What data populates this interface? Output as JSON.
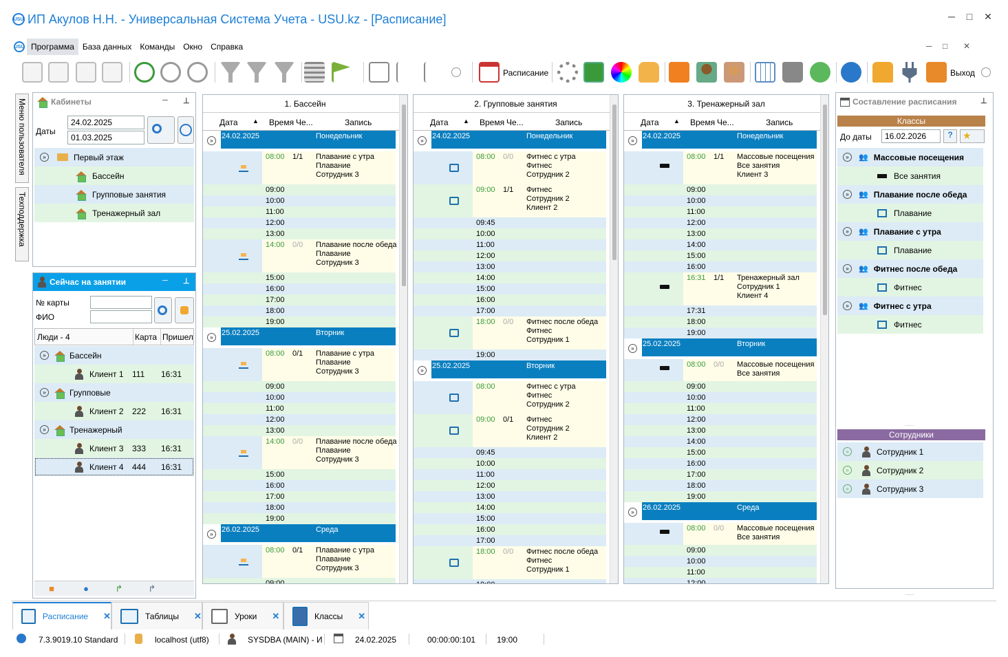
{
  "window": {
    "title": "ИП Акулов Н.Н. - Универсальная Система Учета - USU.kz - [Расписание]",
    "logo": "USU",
    "controls": [
      "─",
      "□",
      "✕"
    ]
  },
  "menu": {
    "items": [
      "Программа",
      "База данных",
      "Команды",
      "Окно",
      "Справка"
    ]
  },
  "toolbar": {
    "schedule_label": "Расписание",
    "exit_label": "Выход"
  },
  "side_tabs": [
    "Меню пользователя",
    "Техподдержка"
  ],
  "cabinets": {
    "title": "Кабинеты",
    "dates_label": "Даты",
    "date_from": "24.02.2025",
    "date_to": "01.03.2025",
    "tree": {
      "root": "Первый этаж",
      "children": [
        "Бассейн",
        "Групповые занятия",
        "Тренажерный зал"
      ]
    }
  },
  "now": {
    "title": "Сейчас на занятии",
    "card_label": "№ карты",
    "name_label": "ФИО",
    "columns": [
      "Люди - 4",
      "Карта",
      "Пришел"
    ],
    "groups": [
      {
        "name": "Бассейн",
        "clients": [
          {
            "name": "Клиент 1",
            "card": "111",
            "time": "16:31"
          }
        ]
      },
      {
        "name": "Групповые",
        "clients": [
          {
            "name": "Клиент 2",
            "card": "222",
            "time": "16:31"
          }
        ]
      },
      {
        "name": "Тренажерный",
        "clients": [
          {
            "name": "Клиент 3",
            "card": "333",
            "time": "16:31"
          },
          {
            "name": "Клиент 4",
            "card": "444",
            "time": "16:31"
          }
        ]
      }
    ]
  },
  "grid_columns": {
    "date": "Дата",
    "time": "Время",
    "count": "Че...",
    "record": "Запись"
  },
  "schedules": [
    {
      "title": "1. Бассейн",
      "rows": [
        {
          "k": "day",
          "date": "24.02.2025",
          "dow": "Понедельник"
        },
        {
          "k": "e",
          "time": "08:00",
          "n": "1/1",
          "text": "Плавание с утра\nПлавание\nСотрудник 3",
          "icon": "swim"
        },
        {
          "k": "s",
          "time": "09:00"
        },
        {
          "k": "s",
          "time": "10:00"
        },
        {
          "k": "s",
          "time": "11:00"
        },
        {
          "k": "s",
          "time": "12:00"
        },
        {
          "k": "s",
          "time": "13:00"
        },
        {
          "k": "e",
          "time": "14:00",
          "n": "0/0",
          "text": "Плавание после обеда\nПлавание\nСотрудник 3",
          "icon": "swim"
        },
        {
          "k": "s",
          "time": "15:00"
        },
        {
          "k": "s",
          "time": "16:00"
        },
        {
          "k": "s",
          "time": "17:00"
        },
        {
          "k": "s",
          "time": "18:00"
        },
        {
          "k": "s",
          "time": "19:00"
        },
        {
          "k": "day",
          "date": "25.02.2025",
          "dow": "Вторник"
        },
        {
          "k": "e",
          "time": "08:00",
          "n": "0/1",
          "text": "Плавание с утра\nПлавание\nСотрудник 3",
          "icon": "swim"
        },
        {
          "k": "s",
          "time": "09:00"
        },
        {
          "k": "s",
          "time": "10:00"
        },
        {
          "k": "s",
          "time": "11:00"
        },
        {
          "k": "s",
          "time": "12:00"
        },
        {
          "k": "s",
          "time": "13:00"
        },
        {
          "k": "e",
          "time": "14:00",
          "n": "0/0",
          "text": "Плавание после обеда\nПлавание\nСотрудник 3",
          "icon": "swim"
        },
        {
          "k": "s",
          "time": "15:00"
        },
        {
          "k": "s",
          "time": "16:00"
        },
        {
          "k": "s",
          "time": "17:00"
        },
        {
          "k": "s",
          "time": "18:00"
        },
        {
          "k": "s",
          "time": "19:00"
        },
        {
          "k": "day",
          "date": "26.02.2025",
          "dow": "Среда"
        },
        {
          "k": "e",
          "time": "08:00",
          "n": "0/1",
          "text": "Плавание с утра\nПлавание\nСотрудник 3",
          "icon": "swim"
        },
        {
          "k": "s",
          "time": "09:00"
        }
      ]
    },
    {
      "title": "2. Групповые занятия",
      "rows": [
        {
          "k": "day",
          "date": "24.02.2025",
          "dow": "Понедельник"
        },
        {
          "k": "e",
          "time": "08:00",
          "n": "0/0",
          "text": "Фитнес с утра\nФитнес\nСотрудник 2",
          "icon": "run"
        },
        {
          "k": "e",
          "time": "09:00",
          "n": "1/1",
          "text": "Фитнес\nСотрудник 2\nКлиент 2",
          "icon": "run"
        },
        {
          "k": "s",
          "time": "09:45"
        },
        {
          "k": "s",
          "time": "10:00"
        },
        {
          "k": "s",
          "time": "11:00"
        },
        {
          "k": "s",
          "time": "12:00"
        },
        {
          "k": "s",
          "time": "13:00"
        },
        {
          "k": "s",
          "time": "14:00"
        },
        {
          "k": "s",
          "time": "15:00"
        },
        {
          "k": "s",
          "time": "16:00"
        },
        {
          "k": "s",
          "time": "17:00"
        },
        {
          "k": "e",
          "time": "18:00",
          "n": "0/0",
          "text": "Фитнес после обеда\nФитнес\nСотрудник 1",
          "icon": "run"
        },
        {
          "k": "s",
          "time": "19:00"
        },
        {
          "k": "day",
          "date": "25.02.2025",
          "dow": "Вторник"
        },
        {
          "k": "e",
          "time": "08:00",
          "n": "",
          "text": "Фитнес с утра\nФитнес\nСотрудник 2",
          "icon": "run"
        },
        {
          "k": "e",
          "time": "09:00",
          "n": "0/1",
          "text": "Фитнес\nСотрудник 2\nКлиент 2",
          "icon": "run"
        },
        {
          "k": "s",
          "time": "09:45"
        },
        {
          "k": "s",
          "time": "10:00"
        },
        {
          "k": "s",
          "time": "11:00"
        },
        {
          "k": "s",
          "time": "12:00"
        },
        {
          "k": "s",
          "time": "13:00"
        },
        {
          "k": "s",
          "time": "14:00"
        },
        {
          "k": "s",
          "time": "15:00"
        },
        {
          "k": "s",
          "time": "16:00"
        },
        {
          "k": "s",
          "time": "17:00"
        },
        {
          "k": "e",
          "time": "18:00",
          "n": "0/0",
          "text": "Фитнес после обеда\nФитнес\nСотрудник 1",
          "icon": "run"
        },
        {
          "k": "s",
          "time": "19:00"
        }
      ]
    },
    {
      "title": "3. Тренажерный зал",
      "rows": [
        {
          "k": "day",
          "date": "24.02.2025",
          "dow": "Понедельник"
        },
        {
          "k": "e",
          "time": "08:00",
          "n": "1/1",
          "text": "Массовые посещения\nВсе занятия\nКлиент 3",
          "icon": "dumb"
        },
        {
          "k": "s",
          "time": "09:00"
        },
        {
          "k": "s",
          "time": "10:00"
        },
        {
          "k": "s",
          "time": "11:00"
        },
        {
          "k": "s",
          "time": "12:00"
        },
        {
          "k": "s",
          "time": "13:00"
        },
        {
          "k": "s",
          "time": "14:00"
        },
        {
          "k": "s",
          "time": "15:00"
        },
        {
          "k": "s",
          "time": "16:00"
        },
        {
          "k": "e",
          "time": "16:31",
          "n": "1/1",
          "text": "Тренажерный зал\nСотрудник 1\nКлиент 4",
          "icon": "dumb"
        },
        {
          "k": "s",
          "time": "17:31"
        },
        {
          "k": "s",
          "time": "18:00"
        },
        {
          "k": "s",
          "time": "19:00"
        },
        {
          "k": "day",
          "date": "25.02.2025",
          "dow": "Вторник"
        },
        {
          "k": "e2",
          "time": "08:00",
          "n": "0/0",
          "text": "Массовые посещения\nВсе занятия",
          "icon": "dumb"
        },
        {
          "k": "s",
          "time": "09:00"
        },
        {
          "k": "s",
          "time": "10:00"
        },
        {
          "k": "s",
          "time": "11:00"
        },
        {
          "k": "s",
          "time": "12:00"
        },
        {
          "k": "s",
          "time": "13:00"
        },
        {
          "k": "s",
          "time": "14:00"
        },
        {
          "k": "s",
          "time": "15:00"
        },
        {
          "k": "s",
          "time": "16:00"
        },
        {
          "k": "s",
          "time": "17:00"
        },
        {
          "k": "s",
          "time": "18:00"
        },
        {
          "k": "s",
          "time": "19:00"
        },
        {
          "k": "day",
          "date": "26.02.2025",
          "dow": "Среда"
        },
        {
          "k": "e2",
          "time": "08:00",
          "n": "0/0",
          "text": "Массовые посещения\nВсе занятия",
          "icon": "dumb"
        },
        {
          "k": "s",
          "time": "09:00"
        },
        {
          "k": "s",
          "time": "10:00"
        },
        {
          "k": "s",
          "time": "11:00"
        },
        {
          "k": "s",
          "time": "12:00"
        }
      ]
    }
  ],
  "composer": {
    "title": "Составление расписания",
    "classes_header": "Классы",
    "until_label": "До даты",
    "until_date": "16.02.2026",
    "classes": [
      {
        "name": "Массовые посещения",
        "child": "Все занятия"
      },
      {
        "name": "Плавание после обеда",
        "child": "Плавание"
      },
      {
        "name": "Плавание с утра",
        "child": "Плавание"
      },
      {
        "name": "Фитнес после обеда",
        "child": "Фитнес"
      },
      {
        "name": "Фитнес с утра",
        "child": "Фитнес"
      }
    ],
    "staff_header": "Сотрудники",
    "staff": [
      "Сотрудник 1",
      "Сотрудник 2",
      "Сотрудник 3"
    ]
  },
  "doc_tabs": [
    "Расписание",
    "Таблицы",
    "Уроки",
    "Классы"
  ],
  "status": {
    "version": "7.3.9019.10 Standard",
    "db": "localhost (utf8)",
    "user": "SYSDBA (MAIN) - И",
    "date": "24.02.2025",
    "timer": "00:00:00:101",
    "time": "19:00"
  },
  "colors": {
    "accent": "#1e7fd6",
    "day_bar": "#0a7fc0",
    "classes_hdr": "#b8824a",
    "staff_hdr": "#8a6aa0",
    "now_hdr": "#0aa0e8"
  }
}
